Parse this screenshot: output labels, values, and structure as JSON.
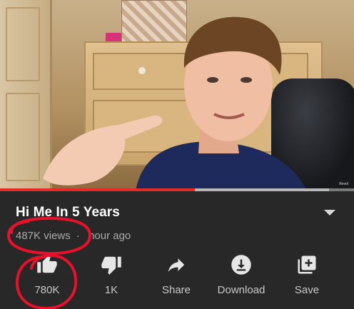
{
  "video": {
    "watermark": "Revol",
    "progress_percent": 55,
    "buffer_percent": 93
  },
  "info": {
    "title": "Hi Me In 5 Years",
    "views": "487K views",
    "separator": "·",
    "time_ago": "hour ago"
  },
  "actions": {
    "like": {
      "label": "780K",
      "icon": "thumbs-up-icon"
    },
    "dislike": {
      "label": "1K",
      "icon": "thumbs-down-icon"
    },
    "share": {
      "label": "Share",
      "icon": "share-icon"
    },
    "download": {
      "label": "Download",
      "icon": "download-icon"
    },
    "save": {
      "label": "Save",
      "icon": "add-to-playlist-icon"
    }
  },
  "colors": {
    "background": "#282828",
    "progress_played": "#e52d27",
    "annotation": "#e8102a",
    "text_secondary": "#aaaaaa"
  }
}
